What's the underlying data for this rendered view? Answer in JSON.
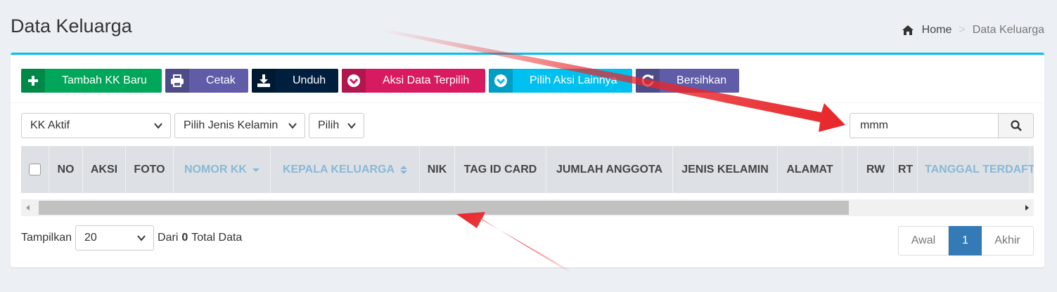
{
  "page": {
    "title": "Data Keluarga"
  },
  "breadcrumb": {
    "home": "Home",
    "sep": ">",
    "current": "Data Keluarga"
  },
  "toolbar": {
    "add": "Tambah KK Baru",
    "print": "Cetak",
    "download": "Unduh",
    "bulk_action": "Aksi Data Terpilih",
    "other_action": "Pilih Aksi Lainnya",
    "clear": "Bersihkan"
  },
  "filters": {
    "status": "KK Aktif",
    "gender": "Pilih Jenis Kelamin",
    "other": "Pilih"
  },
  "search": {
    "value": "mmm"
  },
  "table": {
    "columns": [
      "NO",
      "AKSI",
      "FOTO",
      "NOMOR KK",
      "KEPALA KELUARGA",
      "NIK",
      "TAG ID CARD",
      "JUMLAH ANGGOTA",
      "JENIS KELAMIN",
      "ALAMAT",
      "RW",
      "RT",
      "TANGGAL TERDAFTAR"
    ]
  },
  "footer": {
    "show_label": "Tampilkan",
    "per_page": "20",
    "from_label": "Dari",
    "total": "0",
    "total_label": "Total Data"
  },
  "pagination": {
    "first": "Awal",
    "current": "1",
    "last": "Akhir"
  },
  "colors": {
    "accent": "#00c0ef",
    "annotation": "#e8262a"
  }
}
